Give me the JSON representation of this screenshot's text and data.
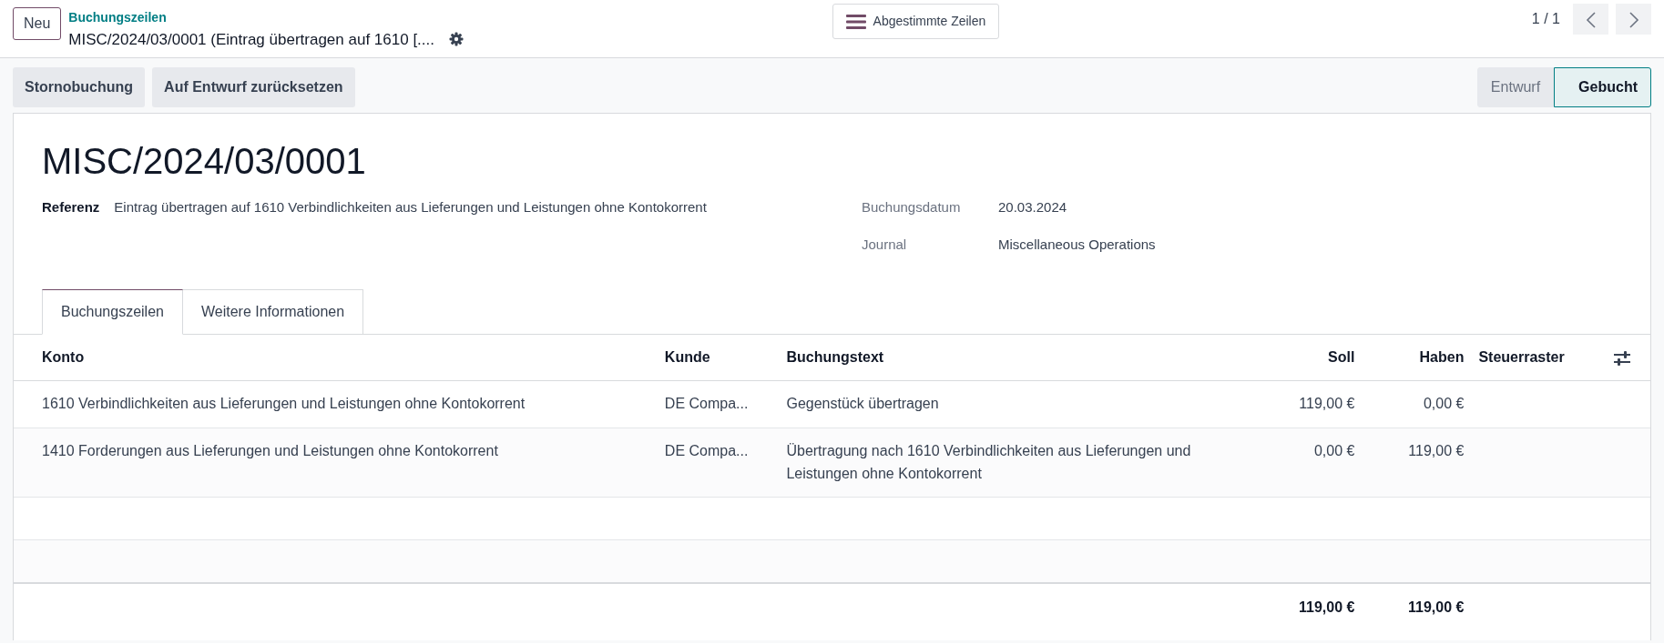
{
  "header": {
    "new_button": "Neu",
    "breadcrumb": "Buchungszeilen",
    "record_title": "MISC/2024/03/0001 (Eintrag übertragen auf 1610 [....",
    "reconciled_button": "Abgestimmte Zeilen",
    "pager": "1 / 1"
  },
  "actions": [
    "Stornobuchung",
    "Auf Entwurf zurücksetzen"
  ],
  "statusbar": [
    {
      "label": "Entwurf",
      "selected": false
    },
    {
      "label": "Gebucht",
      "selected": true
    }
  ],
  "form": {
    "title": "MISC/2024/03/0001",
    "left_fields": [
      {
        "label": "Referenz",
        "value": "Eintrag übertragen auf 1610 Verbindlichkeiten aus Lieferungen und Leistungen ohne Kontokorrent"
      }
    ],
    "right_fields": [
      {
        "label": "Buchungsdatum",
        "value": "20.03.2024"
      },
      {
        "label": "Journal",
        "value": "Miscellaneous Operations"
      }
    ]
  },
  "tabs": [
    {
      "label": "Buchungszeilen",
      "selected": true
    },
    {
      "label": "Weitere Informationen",
      "selected": false
    }
  ],
  "table": {
    "columns": [
      "Konto",
      "Kunde",
      "Buchungstext",
      "Soll",
      "Haben",
      "Steuerraster"
    ],
    "rows": [
      [
        "1610 Verbindlichkeiten aus Lieferungen und Leistungen ohne Kontokorrent",
        "DE Compa...",
        "Gegenstück übertragen",
        "119,00 €",
        "0,00 €",
        ""
      ],
      [
        "1410 Forderungen aus Lieferungen und Leistungen ohne Kontokorrent",
        "DE Compa...",
        "Übertragung nach 1610 Verbindlichkeiten aus Lieferungen und Leistungen ohne Kontokorrent",
        "0,00 €",
        "119,00 €",
        ""
      ]
    ],
    "totals": {
      "debit": "119,00 €",
      "credit": "119,00 €"
    }
  }
}
